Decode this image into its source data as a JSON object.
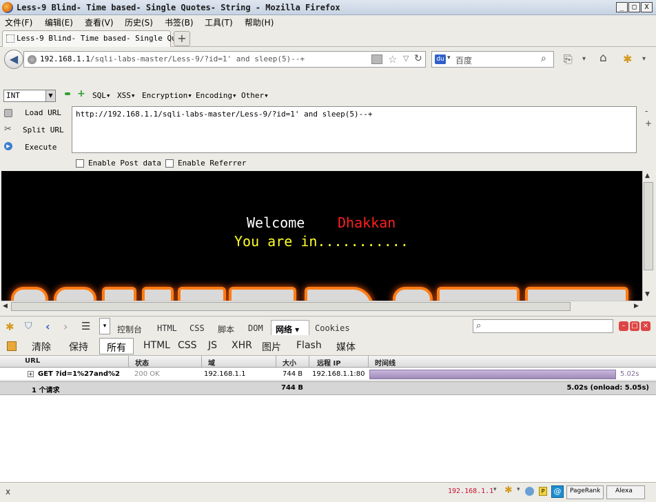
{
  "window": {
    "title": "Less-9 Blind- Time based- Single Quotes- String - Mozilla Firefox",
    "min": "_",
    "max": "□",
    "close": "X"
  },
  "menu": [
    "文件(F)",
    "编辑(E)",
    "查看(V)",
    "历史(S)",
    "书签(B)",
    "工具(T)",
    "帮助(H)"
  ],
  "tab": {
    "label": "Less-9 Blind- Time based- Single Qu…",
    "new_tab": "+"
  },
  "nav": {
    "url_host": "192.168.1.1",
    "url_path": "/sqli-labs-master/Less-9/?id=1' and sleep(5)--+",
    "search_placeholder": "百度"
  },
  "hackbar": {
    "select_value": "INT",
    "menus": [
      "SQL▾",
      "XSS▾",
      "Encryption▾",
      "Encoding▾",
      "Other▾"
    ],
    "load_url": "Load URL",
    "split_url": "Split URL",
    "execute": "Execute",
    "textarea": "http://192.168.1.1/sqli-labs-master/Less-9/?id=1' and sleep(5)--+",
    "enable_post": "Enable Post data",
    "enable_referrer": "Enable Referrer",
    "side_minus": "-",
    "side_plus": "+"
  },
  "page": {
    "welcome": "Welcome",
    "name": "Dhakkan",
    "message": "You are in..........."
  },
  "firebug": {
    "tabs": [
      "控制台",
      "HTML",
      "CSS",
      "脚本",
      "DOM",
      "网络 ▾",
      "Cookies"
    ],
    "net_buttons": [
      "清除",
      "保持",
      "所有",
      "HTML",
      "CSS",
      "JS",
      "XHR",
      "图片",
      "Flash",
      "媒体"
    ],
    "columns": [
      "URL",
      "状态",
      "域",
      "大小",
      "远程 IP",
      "时间线"
    ],
    "row": {
      "url": "GET ?id=1%27and%2",
      "status": "200 OK",
      "domain": "192.168.1.1",
      "size": "744 B",
      "remote_ip": "192.168.1.1:80",
      "time": "5.02s"
    },
    "summary": {
      "requests": "1 个请求",
      "size": "744 B",
      "time": "5.02s (onload: 5.05s)"
    }
  },
  "statusbar": {
    "close": "x",
    "ip": "192.168.1.1",
    "pagerank": "PageRank",
    "alexa": "Alexa"
  }
}
